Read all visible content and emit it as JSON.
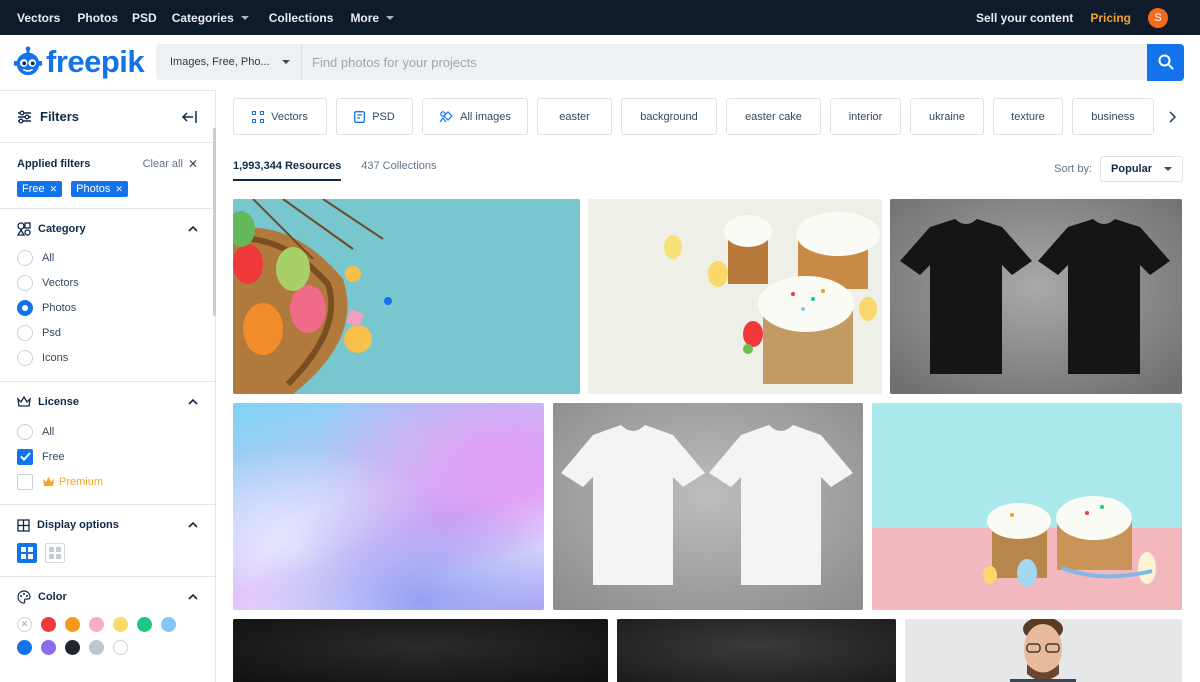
{
  "topnav": {
    "items": [
      "Vectors",
      "Photos",
      "PSD",
      "Categories",
      "Collections",
      "More"
    ],
    "sell": "Sell your content",
    "pricing": "Pricing",
    "avatar_letter": "S"
  },
  "header": {
    "logo_text": "freepik",
    "search_type": "Images, Free, Pho...",
    "search_placeholder": "Find photos for your projects"
  },
  "sidebar": {
    "title": "Filters",
    "applied_label": "Applied filters",
    "clear_all": "Clear all",
    "chips": [
      "Free",
      "Photos"
    ],
    "category": {
      "title": "Category",
      "options": [
        "All",
        "Vectors",
        "Photos",
        "Psd",
        "Icons"
      ],
      "selected": "Photos"
    },
    "license": {
      "title": "License",
      "options": [
        "All",
        "Free",
        "Premium"
      ],
      "checked": [
        "Free"
      ]
    },
    "display": {
      "title": "Display options"
    },
    "color": {
      "title": "Color",
      "swatches": [
        "none",
        "#f0393a",
        "#f5991c",
        "#f7aebe",
        "#f9d96b",
        "#1ec882",
        "#84c6f5",
        "#1273eb",
        "#8a6cf0",
        "#1f2630",
        "#bcc7d1",
        "#ffffff"
      ]
    }
  },
  "tags": [
    {
      "label": "Vectors",
      "icon": "vectors-icon"
    },
    {
      "label": "PSD",
      "icon": "psd-icon"
    },
    {
      "label": "All images",
      "icon": "all-images-icon"
    },
    {
      "label": "easter"
    },
    {
      "label": "background"
    },
    {
      "label": "easter cake"
    },
    {
      "label": "interior"
    },
    {
      "label": "ukraine"
    },
    {
      "label": "texture"
    },
    {
      "label": "business"
    }
  ],
  "results": {
    "resources": "1,993,344 Resources",
    "collections": "437 Collections",
    "sort_label": "Sort by:",
    "sort_value": "Popular"
  }
}
